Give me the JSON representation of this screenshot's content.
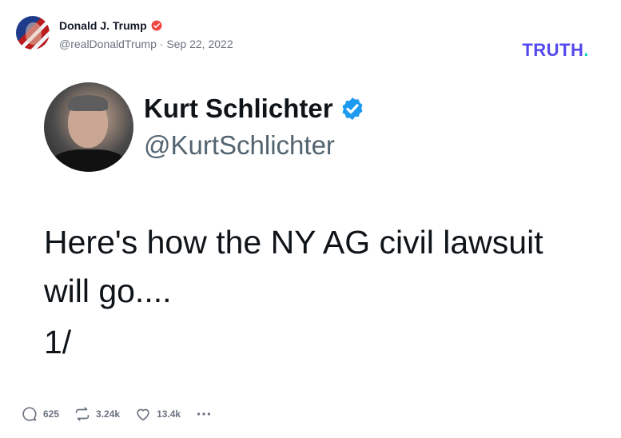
{
  "header": {
    "display_name": "Donald J. Trump",
    "handle": "@realDonaldTrump",
    "separator": "·",
    "date": "Sep 22, 2022",
    "brand_text": "TRUTH",
    "brand_dot": ".",
    "brand_color": "#5448ee",
    "brand_dot_color": "#12d8c3",
    "verified_icon": "verified-badge-icon"
  },
  "embedded_tweet": {
    "name": "Kurt Schlichter",
    "handle": "@KurtSchlichter",
    "text": "Here's how the NY AG civil lawsuit will go....",
    "thread_marker": "1/",
    "verified_color": "#1d9bf0"
  },
  "actions": {
    "replies": "625",
    "retruths": "3.24k",
    "likes": "13.4k",
    "reply_icon": "reply-icon",
    "retruth_icon": "retruth-icon",
    "like_icon": "heart-icon",
    "more_icon": "more-dots-icon"
  }
}
